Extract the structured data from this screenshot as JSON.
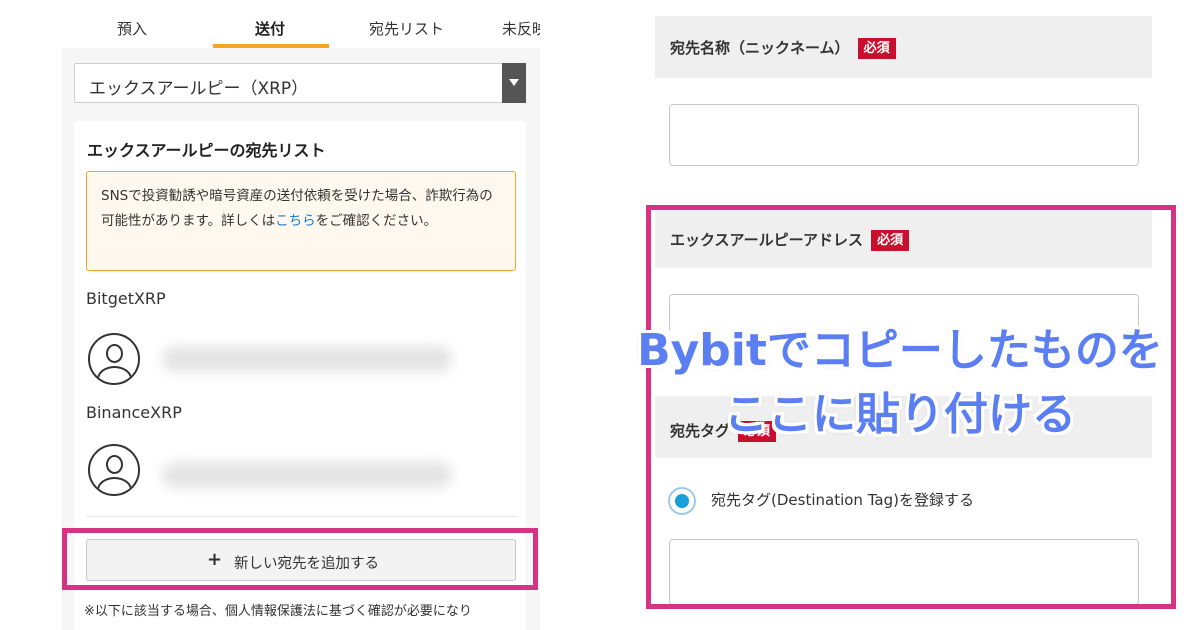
{
  "tabs": [
    {
      "label": "預入",
      "active": false
    },
    {
      "label": "送付",
      "active": true
    },
    {
      "label": "宛先リスト",
      "active": false
    },
    {
      "label": "未反映",
      "active": false
    }
  ],
  "currency_select": {
    "value": "エックスアールピー（XRP）"
  },
  "list_card": {
    "title": "エックスアールピーの宛先リスト",
    "notice_text_1": "SNSで投資勧誘や暗号資産の送付依頼を受けた場合、詐欺行為の可能性があります。詳しくは",
    "notice_link": "こちら",
    "notice_text_2": "をご確認ください。",
    "entries": [
      {
        "name": "BitgetXRP",
        "icon": "user-avatar-icon"
      },
      {
        "name": "BinanceXRP",
        "icon": "user-avatar-icon"
      }
    ],
    "add_button_icon": "+",
    "add_button_label": "新しい宛先を追加する",
    "footnote": "※以下に該当する場合、個人情報保護法に基づく確認が必要になり"
  },
  "form": {
    "name_label": "宛先名称（ニックネーム）",
    "address_label": "エックスアールピーアドレス",
    "tag_label": "宛先タグ",
    "required_badge": "必須",
    "radio_label": "宛先タグ(Destination Tag)を登録する",
    "radio_checked": true
  },
  "overlay": {
    "line1": "Bybitでコピーしたものを",
    "line2": "ここに貼り付ける"
  },
  "colors": {
    "highlight_border": "#d63384",
    "tab_underline": "#f5a623",
    "required_badge": "#c8102e",
    "overlay_text": "#5b7ff2",
    "radio": "#1a9fd8",
    "link": "#1a7ccc"
  }
}
